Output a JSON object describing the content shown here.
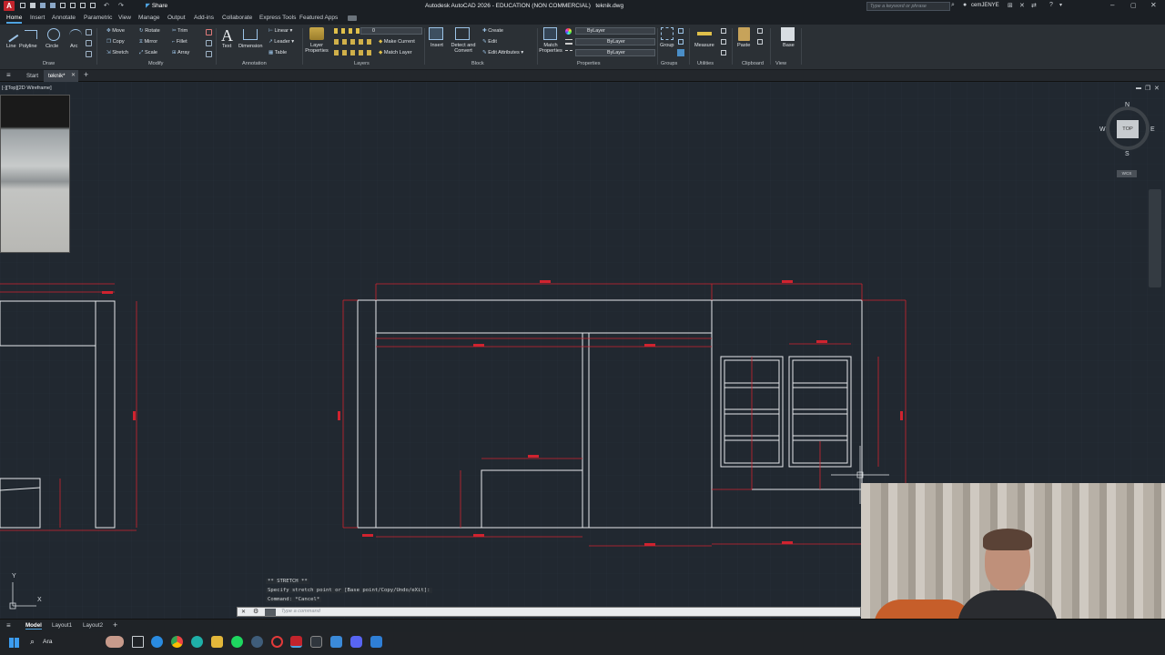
{
  "app": {
    "title": "Autodesk AutoCAD 2026 - EDUCATION (NON COMMERCIAL)   teknik.dwg",
    "share_label": "Share",
    "search_placeholder": "Type a keyword or phrase",
    "user": "cemJENYE"
  },
  "ribbon_tabs": [
    "Home",
    "Insert",
    "Annotate",
    "Parametric",
    "View",
    "Manage",
    "Output",
    "Add-ins",
    "Collaborate",
    "Express Tools",
    "Featured Apps"
  ],
  "draw": {
    "line": "Line",
    "polyline": "Polyline",
    "circle": "Circle",
    "arc": "Arc",
    "group": "Draw"
  },
  "modify": {
    "move": "Move",
    "rotate": "Rotate",
    "trim": "Trim",
    "copy": "Copy",
    "mirror": "Mirror",
    "fillet": "Fillet",
    "stretch": "Stretch",
    "scale": "Scale",
    "array": "Array",
    "group": "Modify"
  },
  "annotation": {
    "text": "Text",
    "dimension": "Dimension",
    "linear": "Linear",
    "leader": "Leader",
    "table": "Table",
    "group": "Annotation"
  },
  "layers": {
    "layer_properties": "Layer Properties",
    "layer_value": "0",
    "make_current": "Make Current",
    "match_layer": "Match Layer",
    "group": "Layers"
  },
  "block": {
    "insert": "Insert",
    "detect_convert": "Detect and Convert",
    "create": "Create",
    "edit": "Edit",
    "edit_attributes": "Edit Attributes",
    "group": "Block"
  },
  "properties": {
    "match_properties": "Match Properties",
    "color": "ByLayer",
    "linetype": "ByLayer",
    "lineweight": "ByLayer",
    "group": "Properties"
  },
  "groups": {
    "group": "Group",
    "label": "Groups"
  },
  "utilities": {
    "measure": "Measure",
    "label": "Utilities"
  },
  "clipboard": {
    "paste": "Paste",
    "label": "Clipboard"
  },
  "view": {
    "base": "Base",
    "label": "View"
  },
  "file_tabs": [
    "Start",
    "teknik*"
  ],
  "viewport": {
    "label": "[-][Top][2D Wireframe]",
    "compass": {
      "n": "N",
      "s": "S",
      "e": "E",
      "w": "W",
      "top": "TOP",
      "wcs": "WCS"
    }
  },
  "command": {
    "history": [
      "** STRETCH **",
      "Specify stretch point or [Base point/Copy/Undo/eXit]:",
      "Command: *Cancel*"
    ],
    "placeholder": "Type a command"
  },
  "status_tabs": [
    "Model",
    "Layout1",
    "Layout2"
  ],
  "taskbar": {
    "search_label": "Ara"
  },
  "colors": {
    "background": "#212830",
    "geometry": "#e6e9ec",
    "dimension": "#d0232f",
    "accent": "#4fa3e0"
  }
}
